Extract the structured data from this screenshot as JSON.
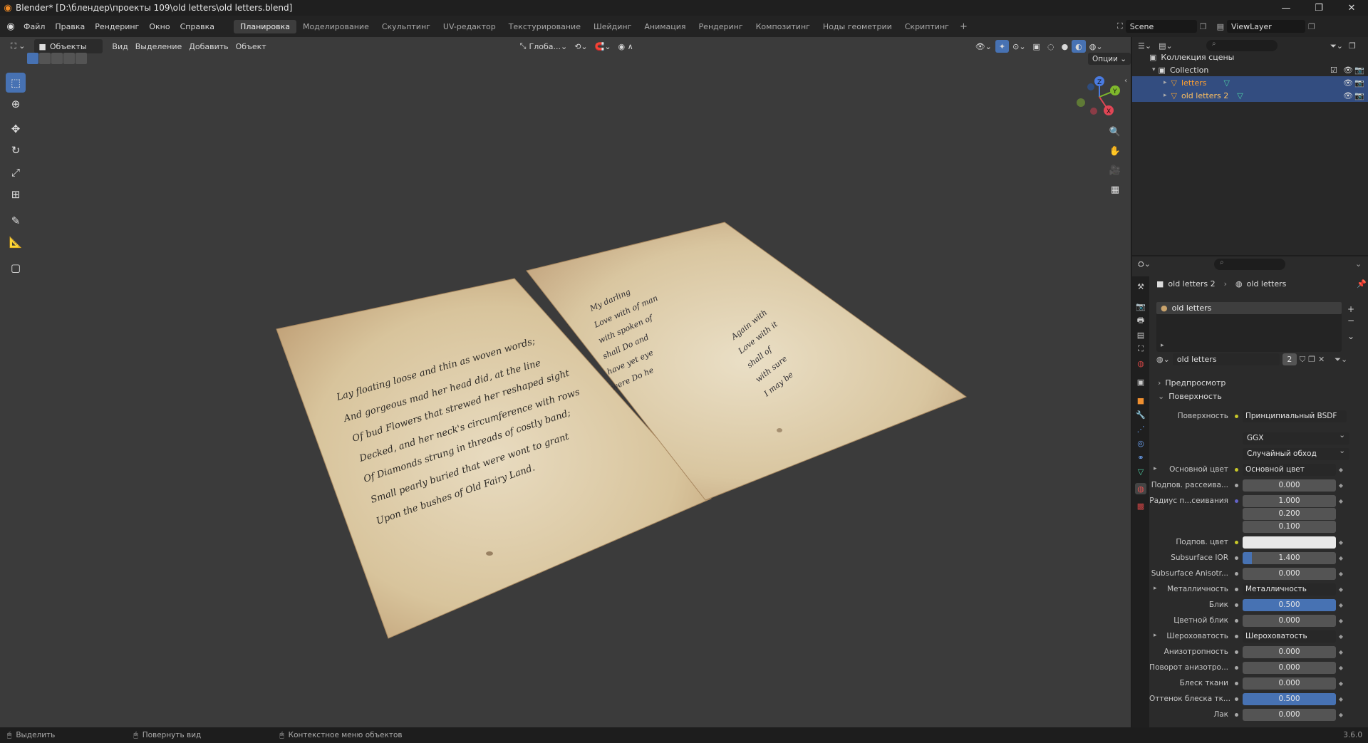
{
  "window": {
    "title": "Blender* [D:\\блендер\\проекты 109\\old letters\\old letters.blend]",
    "controls": [
      "minimize-icon",
      "restore-icon",
      "close-icon"
    ]
  },
  "menu": [
    "Файл",
    "Правка",
    "Рендеринг",
    "Окно",
    "Справка"
  ],
  "workspaces": [
    "Планировка",
    "Моделирование",
    "Скульптинг",
    "UV-редактор",
    "Текстурирование",
    "Шейдинг",
    "Анимация",
    "Рендеринг",
    "Композитинг",
    "Ноды геометрии",
    "Скриптинг"
  ],
  "active_workspace": "Планировка",
  "scene": "Scene",
  "view_layer": "ViewLayer",
  "viewport": {
    "mode": "Объекты",
    "menus": [
      "Вид",
      "Выделение",
      "Добавить",
      "Объект"
    ],
    "transform_orientation": "Глоба...",
    "options_label": "Опции",
    "gizmo_axes": [
      "Z",
      "Y",
      "X"
    ],
    "letter_left_text": [
      "Lay floating loose and thin as woven words;",
      "And gorgeous mad her head did, at the line",
      "Of bud Flowers that strewed her reshaped sight",
      "Decked, and her neck's circumference with rows",
      "Of Diamonds strung in threads of costly band;",
      "Small pearly buried that were wont to grant",
      "Upon the bushes of Old Fairy Land."
    ],
    "letter_right_text": [
      "My darling",
      "Love with of man",
      "with spoken of",
      "shall Do and",
      "have yet eye",
      "were Do he"
    ],
    "letter_right_text_b": [
      "Again with",
      "Love with it",
      "shall of",
      "with sure",
      "I may be"
    ]
  },
  "outliner": {
    "root": "Коллекция сцены",
    "collection": "Collection",
    "objects": [
      "letters",
      "old letters 2"
    ]
  },
  "properties": {
    "breadcrumb_object": "old letters 2",
    "breadcrumb_material": "old letters",
    "material_slot": "old letters",
    "material_name": "old letters",
    "user_count": "2",
    "panels": [
      "Предпросмотр",
      "Поверхность"
    ],
    "rows": [
      {
        "label": "Поверхность",
        "value": "Принципиальный BSDF",
        "kind": "link",
        "dot": "y"
      },
      {
        "label": "",
        "value": "GGX",
        "kind": "dd",
        "dot": ""
      },
      {
        "label": "",
        "value": "Случайный обход",
        "kind": "dd",
        "dot": ""
      },
      {
        "label": "Основной цвет",
        "value": "Основной цвет",
        "kind": "link",
        "dot": "y",
        "expand": true
      },
      {
        "label": "Подпов. рассеива...",
        "value": "0.000",
        "kind": "num",
        "dot": "g"
      },
      {
        "label": "Радиус п...сеивания",
        "value": "1.000",
        "kind": "num",
        "dot": "v"
      },
      {
        "label": "",
        "value": "0.200",
        "kind": "num",
        "dot": ""
      },
      {
        "label": "",
        "value": "0.100",
        "kind": "num",
        "dot": ""
      },
      {
        "label": "Подпов. цвет",
        "value": "",
        "kind": "white",
        "dot": "y"
      },
      {
        "label": "Subsurface IOR",
        "value": "1.400",
        "kind": "num",
        "dot": "g",
        "fill": 0.1
      },
      {
        "label": "Subsurface Anisotr...",
        "value": "0.000",
        "kind": "num",
        "dot": "g"
      },
      {
        "label": "Металличность",
        "value": "Металличность",
        "kind": "link",
        "dot": "g",
        "expand": true
      },
      {
        "label": "Блик",
        "value": "0.500",
        "kind": "blue",
        "dot": "g"
      },
      {
        "label": "Цветной блик",
        "value": "0.000",
        "kind": "num",
        "dot": "g"
      },
      {
        "label": "Шероховатость",
        "value": "Шероховатость",
        "kind": "link",
        "dot": "g",
        "expand": true
      },
      {
        "label": "Анизотропность",
        "value": "0.000",
        "kind": "num",
        "dot": "g"
      },
      {
        "label": "Поворот анизотро...",
        "value": "0.000",
        "kind": "num",
        "dot": "g"
      },
      {
        "label": "Блеск ткани",
        "value": "0.000",
        "kind": "num",
        "dot": "g"
      },
      {
        "label": "Оттенок блеска тк...",
        "value": "0.500",
        "kind": "blue",
        "dot": "g"
      },
      {
        "label": "Лак",
        "value": "0.000",
        "kind": "num",
        "dot": "g"
      }
    ]
  },
  "status": {
    "select": "Выделить",
    "rotate_view": "Повернуть вид",
    "context_menu": "Контекстное меню объектов",
    "version": "3.6.0"
  }
}
